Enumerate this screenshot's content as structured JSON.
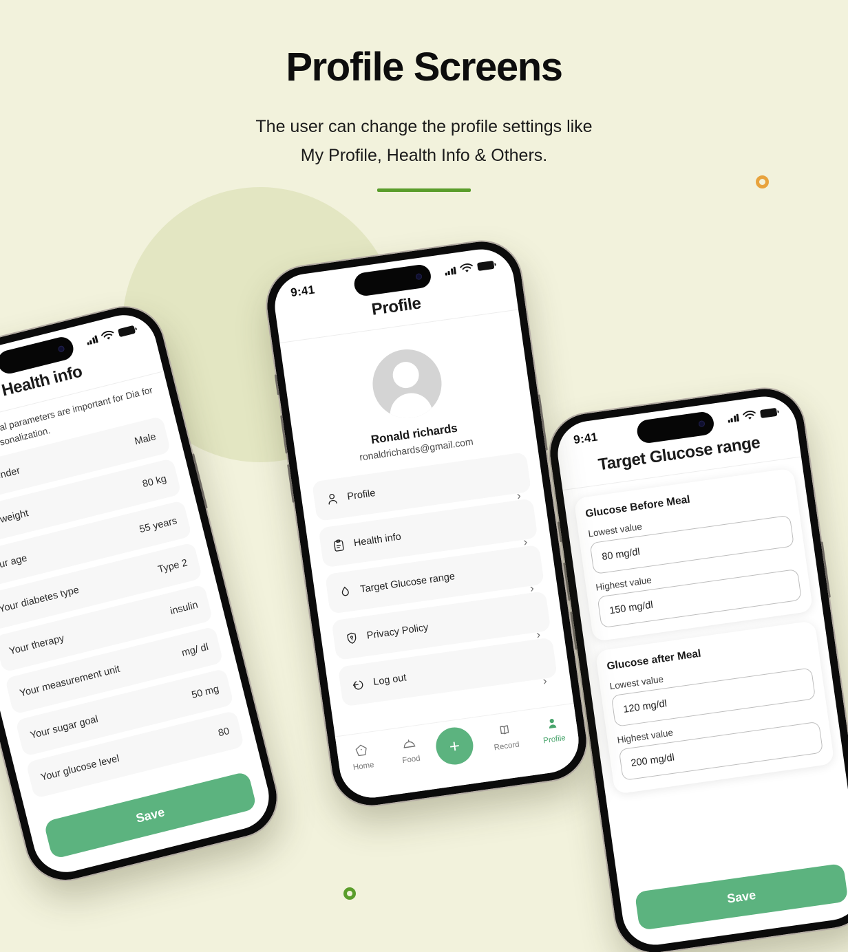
{
  "header": {
    "title": "Profile Screens",
    "subtitle_line1": "The user can change the profile settings like",
    "subtitle_line2": "My Profile, Health Info & Others."
  },
  "colors": {
    "background": "#f2f2dc",
    "circle": "#e3e6c2",
    "accent_green": "#5a9d2b",
    "button_green": "#5cb37f",
    "ring_orange": "#e8a33d"
  },
  "status_bar": {
    "time": "9:41",
    "signal_icon": "cellular-signal-icon",
    "wifi_icon": "wifi-icon",
    "battery_icon": "battery-icon"
  },
  "health_info_screen": {
    "nav_title": "Health info",
    "back_icon": "back-chevron-icon",
    "description": "Your individual parameters are important for Dia for in-depth personalization.",
    "rows": [
      {
        "label": "Your gender",
        "value": "Male"
      },
      {
        "label": "Your weight",
        "value": "80 kg"
      },
      {
        "label": "Your age",
        "value": "55 years"
      },
      {
        "label": "Your diabetes type",
        "value": "Type 2"
      },
      {
        "label": "Your therapy",
        "value": "insulin"
      },
      {
        "label": "Your measurement unit",
        "value": "mg/ dl"
      },
      {
        "label": "Your sugar goal",
        "value": "50 mg"
      },
      {
        "label": "Your glucose level",
        "value": "80"
      }
    ],
    "save_label": "Save"
  },
  "profile_screen": {
    "nav_title": "Profile",
    "avatar_icon": "default-avatar-icon",
    "user_name": "Ronald richards",
    "user_email": "ronaldrichards@gmail.com",
    "menu": [
      {
        "label": "Profile",
        "icon": "user-icon",
        "chevron": "chevron-right-icon"
      },
      {
        "label": "Health info",
        "icon": "clipboard-icon",
        "chevron": "chevron-right-icon"
      },
      {
        "label": "Target Glucose range",
        "icon": "droplet-icon",
        "chevron": "chevron-right-icon"
      },
      {
        "label": "Privacy Policy",
        "icon": "shield-icon",
        "chevron": "chevron-right-icon"
      },
      {
        "label": "Log out",
        "icon": "logout-icon",
        "chevron": "chevron-right-icon"
      }
    ],
    "tabs": [
      {
        "label": "Home",
        "icon": "home-icon",
        "active": false
      },
      {
        "label": "Food",
        "icon": "food-dome-icon",
        "active": false
      },
      {
        "label": "Record",
        "icon": "book-icon",
        "active": false
      },
      {
        "label": "Profile",
        "icon": "person-icon",
        "active": true
      }
    ],
    "add_button_icon": "plus-icon"
  },
  "target_glucose_screen": {
    "nav_title": "Target Glucose range",
    "before_meal": {
      "title": "Glucose Before Meal",
      "lowest_label": "Lowest value",
      "lowest_value": "80 mg/dl",
      "highest_label": "Highest value",
      "highest_value": "150 mg/dl"
    },
    "after_meal": {
      "title": "Glucose after Meal",
      "lowest_label": "Lowest value",
      "lowest_value": "120 mg/dl",
      "highest_label": "Highest value",
      "highest_value": "200 mg/dl"
    },
    "save_label": "Save"
  }
}
